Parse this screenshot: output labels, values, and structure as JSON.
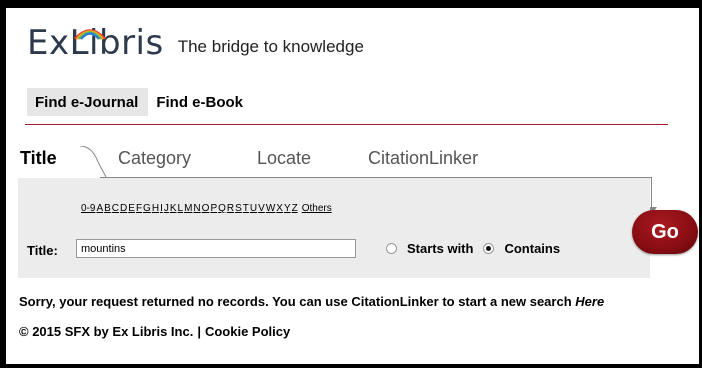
{
  "header": {
    "logo_text": "ExLibris",
    "tagline": "The bridge to knowledge"
  },
  "topnav": [
    {
      "label": "Find e-Journal",
      "active": true
    },
    {
      "label": "Find e-Book",
      "active": false
    }
  ],
  "tabs": [
    {
      "label": "Title",
      "active": true
    },
    {
      "label": "Category",
      "active": false
    },
    {
      "label": "Locate",
      "active": false
    },
    {
      "label": "CitationLinker",
      "active": false
    }
  ],
  "alphabet": [
    "0-9",
    "A",
    "B",
    "C",
    "D",
    "E",
    "F",
    "G",
    "H",
    "I",
    "J",
    "K",
    "L",
    "M",
    "N",
    "O",
    "P",
    "Q",
    "R",
    "S",
    "T",
    "U",
    "V",
    "W",
    "X",
    "Y",
    "Z"
  ],
  "alphabet_others": "Others",
  "search": {
    "label": "Title:",
    "value": "mountins",
    "options": [
      {
        "label": "Starts with",
        "checked": false
      },
      {
        "label": "Contains",
        "checked": true
      }
    ],
    "go_label": "Go"
  },
  "message": {
    "text": "Sorry, your request returned no records. You can use CitationLinker to start a new search ",
    "link": "Here"
  },
  "footer": {
    "copyright": "© 2015 SFX by Ex Libris Inc.",
    "separator": "|",
    "cookie_link": "Cookie Policy"
  },
  "colors": {
    "accent": "#a11e2c",
    "go_button": "#8b0e14",
    "panel_bg": "#ececec",
    "logo_text": "#2d3a4c"
  },
  "icons": {
    "logo_arc": "rainbow-arc-icon"
  }
}
